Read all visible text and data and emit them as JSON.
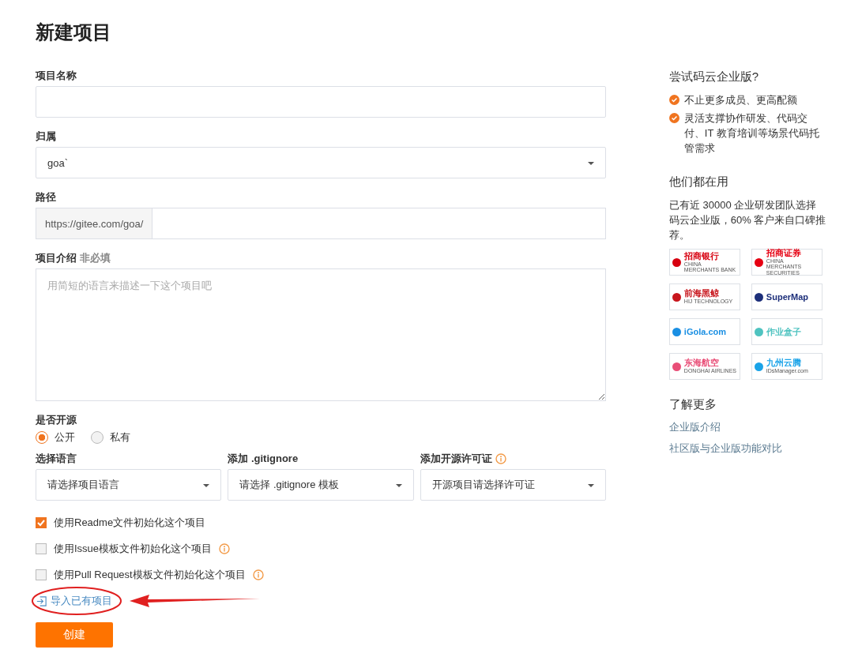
{
  "page_title": "新建项目",
  "form": {
    "name": {
      "label": "项目名称"
    },
    "owner": {
      "label": "归属",
      "value": "goa`"
    },
    "path": {
      "label": "路径",
      "prefix": "https://gitee.com/goa/"
    },
    "description": {
      "label": "项目介绍",
      "optional_tag": "非必填",
      "placeholder": "用简短的语言来描述一下这个项目吧"
    },
    "visibility": {
      "label": "是否开源",
      "options": [
        {
          "label": "公开",
          "selected": true
        },
        {
          "label": "私有",
          "selected": false
        }
      ]
    },
    "dropdowns": [
      {
        "label": "选择语言",
        "value": "请选择项目语言",
        "info": false
      },
      {
        "label": "添加 .gitignore",
        "value": "请选择 .gitignore 模板",
        "info": false
      },
      {
        "label": "添加开源许可证",
        "value": "开源项目请选择许可证",
        "info": true
      }
    ],
    "checkboxes": [
      {
        "label": "使用Readme文件初始化这个项目",
        "checked": true,
        "info": false
      },
      {
        "label": "使用Issue模板文件初始化这个项目",
        "checked": false,
        "info": true
      },
      {
        "label": "使用Pull Request模板文件初始化这个项目",
        "checked": false,
        "info": true
      }
    ],
    "import_link": "导入已有项目",
    "submit": "创建"
  },
  "sidebar": {
    "trial_title": "尝试码云企业版?",
    "benefits": [
      "不止更多成员、更高配额",
      "灵活支撑协作研发、代码交付、IT 教育培训等场景代码托管需求"
    ],
    "users_title": "他们都在用",
    "users_text": "已有近 30000 企业研发团队选择码云企业版，60% 客户来自口碑推荐。",
    "logos": [
      {
        "name": "招商银行",
        "subtitle": "CHINA MERCHANTS BANK",
        "color": "#d7000f"
      },
      {
        "name": "招商证券",
        "subtitle": "CHINA MERCHANTS SECURITIES",
        "color": "#e60012"
      },
      {
        "name": "前海黑鲸",
        "subtitle": "HIJ TECHNOLOGY",
        "color": "#c8161d"
      },
      {
        "name": "SuperMap",
        "color": "#1d2f7a"
      },
      {
        "name": "iGola.com",
        "color": "#1a8fe3"
      },
      {
        "name": "作业盒子",
        "color": "#4fc3c0"
      },
      {
        "name": "东海航空",
        "subtitle": "DONGHAI AIRLINES",
        "color": "#e94e77"
      },
      {
        "name": "九州云腾",
        "subtitle": "IDsManager.com",
        "color": "#1aa3e8"
      }
    ],
    "more_title": "了解更多",
    "links": [
      "企业版介绍",
      "社区版与企业版功能对比"
    ]
  }
}
